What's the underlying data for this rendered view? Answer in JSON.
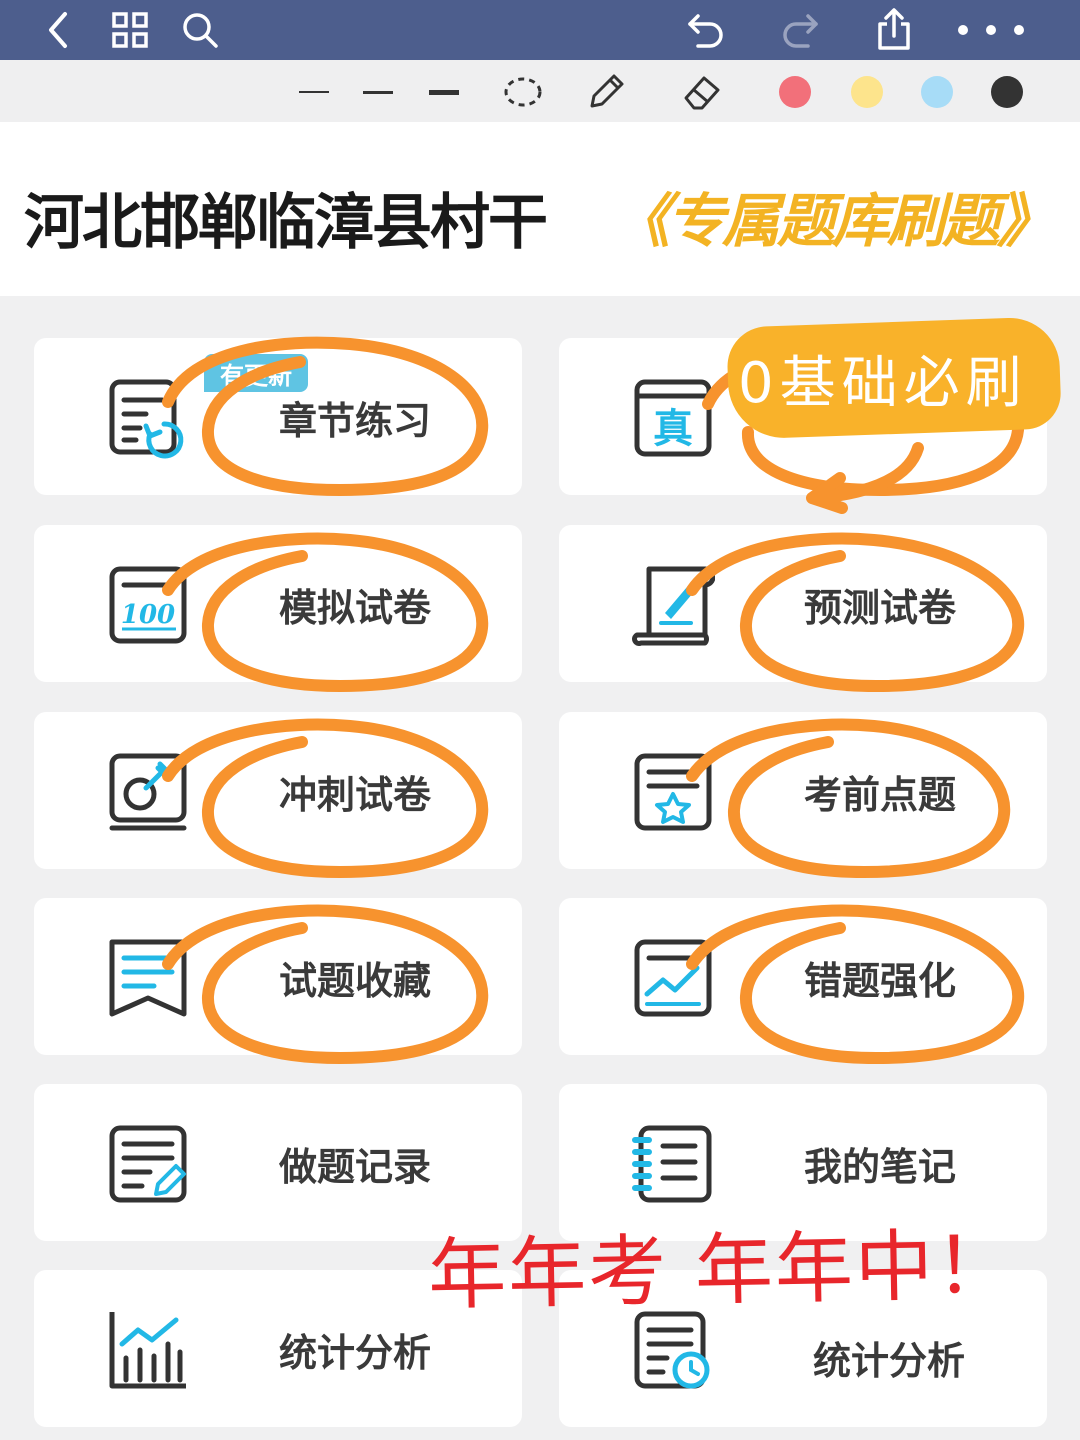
{
  "toolbar": {
    "back_icon": "chevron-left-icon",
    "grid_icon": "grid-icon",
    "search_icon": "search-icon",
    "undo_icon": "undo-icon",
    "redo_icon": "redo-icon",
    "share_icon": "share-icon",
    "more_icon": "more-icon"
  },
  "pen_toolbar": {
    "tools": [
      "thin-line-icon",
      "medium-line-icon",
      "thick-line-icon",
      "lasso-icon",
      "pencil-icon",
      "eraser-icon"
    ],
    "colors": [
      "#f2707a",
      "#fde48c",
      "#a7dcf7",
      "#333333"
    ]
  },
  "header": {
    "title": "河北邯郸临漳县村干",
    "highlight": "《专属题库刷题》"
  },
  "grid": {
    "items": [
      {
        "label": "章节练习",
        "badge": "有更新"
      },
      {
        "label": ""
      },
      {
        "label": "模拟试卷"
      },
      {
        "label": "预测试卷"
      },
      {
        "label": "冲刺试卷"
      },
      {
        "label": "考前点题"
      },
      {
        "label": "试题收藏"
      },
      {
        "label": "错题强化"
      },
      {
        "label": "做题记录"
      },
      {
        "label": "我的笔记"
      },
      {
        "label": "统计分析"
      },
      {
        "label": "统计分析"
      }
    ]
  },
  "annotations": {
    "sticker": "0基础必刷",
    "handwriting": "年年考 年年中！"
  },
  "colors": {
    "topbar": "#4d5e8d",
    "accent_orange": "#f3b323",
    "circle_orange": "#f7932e",
    "icon_teal": "#22b8e6",
    "handwriting_red": "#e8262b"
  }
}
